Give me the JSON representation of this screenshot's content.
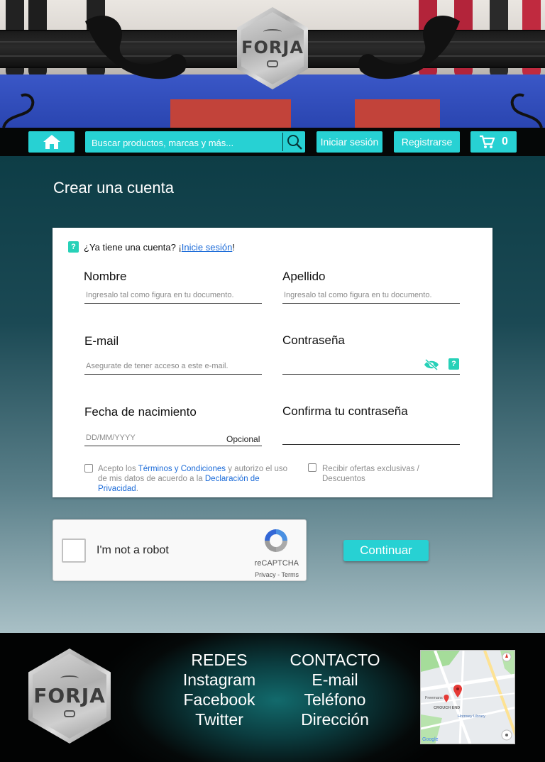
{
  "brand": {
    "logo_text": "FORJA"
  },
  "nav": {
    "search_placeholder": "Buscar productos, marcas y más...",
    "login_label": "Iniciar sesión",
    "register_label": "Registrarse",
    "cart_count": "0"
  },
  "page": {
    "title": "Crear una cuenta"
  },
  "form": {
    "have_account_prefix": "¿Ya tiene una cuenta? ¡",
    "have_account_link": "Inicie sesión",
    "have_account_suffix": "!",
    "nombre_label": "Nombre",
    "nombre_placeholder": "Ingresalo tal como figura en tu documento.",
    "apellido_label": "Apellido",
    "apellido_placeholder": "Ingresalo tal como figura en tu documento.",
    "email_label": "E-mail",
    "email_placeholder": "Asegurate de tener acceso a este e-mail.",
    "password_label": "Contraseña",
    "birth_label": "Fecha de nacimiento",
    "birth_placeholder": "DD/MM/YYYY",
    "birth_optional": "Opcional",
    "confirm_label": "Confirma tu contraseña",
    "terms_part1": "Acepto los ",
    "terms_link1": "Términos y Condiciones",
    "terms_part2": " y autorizo el uso de mis datos de acuerdo a la ",
    "terms_link2": "Declaración de Privacidad",
    "terms_part3": ".",
    "offers_label": "Recibir ofertas exclusivas / Descuentos"
  },
  "captcha": {
    "label": "I'm not a robot",
    "brand": "reCAPTCHA",
    "links": "Privacy - Terms"
  },
  "continue_label": "Continuar",
  "footer": {
    "redes_title": "REDES",
    "redes": [
      "Instagram",
      "Facebook",
      "Twitter"
    ],
    "contacto_title": "CONTACTO",
    "contacto": [
      "E-mail",
      "Teléfono",
      "Dirección"
    ]
  },
  "map": {
    "labels": [
      "Freemans",
      "CROUCH END",
      "Hornsey Library",
      "Google"
    ]
  },
  "colors": {
    "accent": "#27d1d3",
    "link": "#1a6ad8",
    "help": "#27d1b8"
  },
  "icons": [
    "home-icon",
    "search-icon",
    "cart-icon",
    "eye-off-icon",
    "help-icon",
    "recaptcha-icon",
    "map-pin-icon"
  ]
}
